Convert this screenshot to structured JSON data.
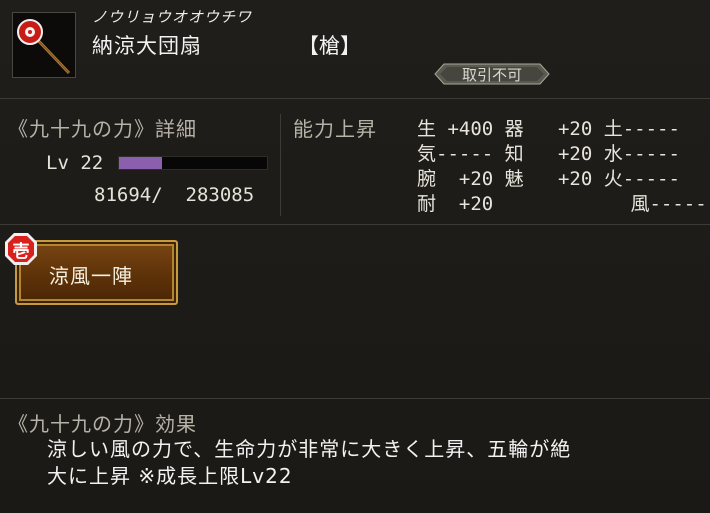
{
  "item": {
    "reading": "ノウリョウオオウチワ",
    "name": "納涼大団扇",
    "weapon_type": "【槍】",
    "trade_status": "取引不可"
  },
  "power": {
    "section_title": "《九十九の力》詳細",
    "level_text": "Lv 22",
    "exp_current": 81694,
    "exp_max": 283085,
    "exp_text": "81694/  283085",
    "exp_fill_fraction": 0.29
  },
  "stats": {
    "title": "能力上昇",
    "rows": [
      "生 +400 器   +20 土-----",
      "気----- 知   +20 水-----",
      "腕  +20 魅   +20 火-----",
      "耐  +20            風-----"
    ]
  },
  "skill": {
    "label": "涼風一陣",
    "badge": "壱"
  },
  "effect": {
    "title": "《九十九の力》効果",
    "lines": [
      "涼しい風の力で、生命力が非常に大きく上昇、五輪が絶",
      "大に上昇 ※成長上限Lv22"
    ]
  },
  "colors": {
    "exp_fill": "#8b5fae",
    "skill_button": "#6a3a0e",
    "skill_border": "#c89a3e",
    "badge_red": "#d8211c",
    "section_label": "#b7b2a7"
  },
  "icons": {
    "item": "fan-icon",
    "skill_badge": "rank-one-badge-icon"
  }
}
